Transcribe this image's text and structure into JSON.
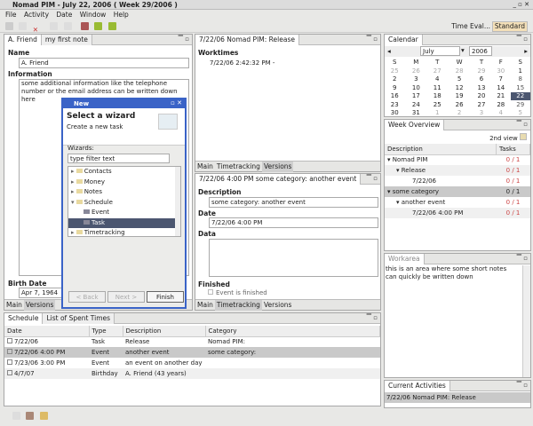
{
  "window": {
    "title": "Nomad PIM - July 22, 2006 ( Week 29/2006 )"
  },
  "menu": [
    "File",
    "Activity",
    "Date",
    "Window",
    "Help"
  ],
  "perspectives": {
    "time_eval": "Time Eval...",
    "standard": "Standard"
  },
  "contact_panel": {
    "tabs": [
      "A. Friend",
      "my first note"
    ],
    "name_label": "Name",
    "name_value": "A. Friend",
    "info_label": "Information",
    "info_value": "some additional information like the telephone number or the email address can be written down here",
    "birth_label": "Birth Date",
    "birth_value": "Apr 7, 1964",
    "bottom_tabs": [
      "Main",
      "Versions"
    ]
  },
  "wizard": {
    "title": "New",
    "heading": "Select a wizard",
    "subtitle": "Create a new task",
    "wizards_label": "Wizards:",
    "filter_value": "type filter text",
    "items": [
      {
        "label": "Contacts",
        "level": 0,
        "icon": "folder"
      },
      {
        "label": "Money",
        "level": 0,
        "icon": "folder"
      },
      {
        "label": "Notes",
        "level": 0,
        "icon": "folder"
      },
      {
        "label": "Schedule",
        "level": 0,
        "icon": "folder-open"
      },
      {
        "label": "Event",
        "level": 1,
        "icon": "event"
      },
      {
        "label": "Task",
        "level": 1,
        "icon": "task",
        "selected": true
      },
      {
        "label": "Timetracking",
        "level": 0,
        "icon": "folder"
      }
    ],
    "back": "< Back",
    "next": "Next >",
    "finish": "Finish"
  },
  "release_panel": {
    "tab": "7/22/06 Nomad PIM: Release",
    "worktimes_label": "Worktimes",
    "worktime_entry": "7/22/06 2:42:32 PM -",
    "bottom_tabs": [
      "Main",
      "Timetracking",
      "Versions"
    ]
  },
  "event_panel": {
    "tab": "7/22/06 4:00 PM some category: another event",
    "desc_label": "Description",
    "desc_value": "some category: another event",
    "date_label": "Date",
    "date_value": "7/22/06 4:00 PM",
    "data_label": "Data",
    "finished_label": "Finished",
    "finished_checkbox": "Event is finished",
    "finished_checked": false,
    "bottom_tabs": [
      "Main",
      "Timetracking",
      "Versions"
    ]
  },
  "calendar": {
    "tab": "Calendar",
    "month": "July",
    "year": "2006",
    "weekdays": [
      "S",
      "M",
      "T",
      "W",
      "T",
      "F",
      "S"
    ],
    "weeks": [
      [
        "25",
        "26",
        "27",
        "28",
        "29",
        "30",
        "1"
      ],
      [
        "2",
        "3",
        "4",
        "5",
        "6",
        "7",
        "8"
      ],
      [
        "9",
        "10",
        "11",
        "12",
        "13",
        "14",
        "15"
      ],
      [
        "16",
        "17",
        "18",
        "19",
        "20",
        "21",
        "22"
      ],
      [
        "23",
        "24",
        "25",
        "26",
        "27",
        "28",
        "29"
      ],
      [
        "30",
        "31",
        "1",
        "2",
        "3",
        "4",
        "5"
      ]
    ],
    "selected": "22"
  },
  "week_overview": {
    "tab": "Week Overview",
    "view_label": "2nd view",
    "columns": [
      "Description",
      "Tasks"
    ],
    "rows": [
      {
        "desc": "Nomad PIM",
        "tasks": "0 / 1",
        "level": 0,
        "expand": true
      },
      {
        "desc": "Release",
        "tasks": "0 / 1",
        "level": 1,
        "expand": true
      },
      {
        "desc": "7/22/06",
        "tasks": "0 / 1",
        "level": 2
      },
      {
        "desc": "some category",
        "tasks": "0 / 1",
        "level": 0,
        "expand": true,
        "selected": true
      },
      {
        "desc": "another event",
        "tasks": "0 / 1",
        "level": 1,
        "expand": true
      },
      {
        "desc": "7/22/06 4:00 PM",
        "tasks": "0 / 1",
        "level": 2
      }
    ]
  },
  "workarea": {
    "tab": "Workarea",
    "text": "this is an area where some short notes can quickly be written down"
  },
  "current_activities": {
    "tab": "Current Activities",
    "items": [
      "7/22/06 Nomad PIM: Release"
    ]
  },
  "schedule": {
    "tabs": [
      "Schedule",
      "List of Spent Times"
    ],
    "columns": [
      "Date",
      "Type",
      "Description",
      "Category"
    ],
    "rows": [
      {
        "date": "7/22/06",
        "type": "Task",
        "desc": "Release",
        "cat": "Nomad PIM:"
      },
      {
        "date": "7/22/06 4:00 PM",
        "type": "Event",
        "desc": "another event",
        "cat": "some category:",
        "selected": true
      },
      {
        "date": "7/23/06 3:00 PM",
        "type": "Event",
        "desc": "an event on another day",
        "cat": ""
      },
      {
        "date": "4/7/07",
        "type": "Birthday",
        "desc": "A. Friend (43 years)",
        "cat": ""
      }
    ]
  },
  "colors": {
    "selection": "#4b5670",
    "dialog_border": "#3a63c7",
    "task_count": "#cc4444"
  }
}
